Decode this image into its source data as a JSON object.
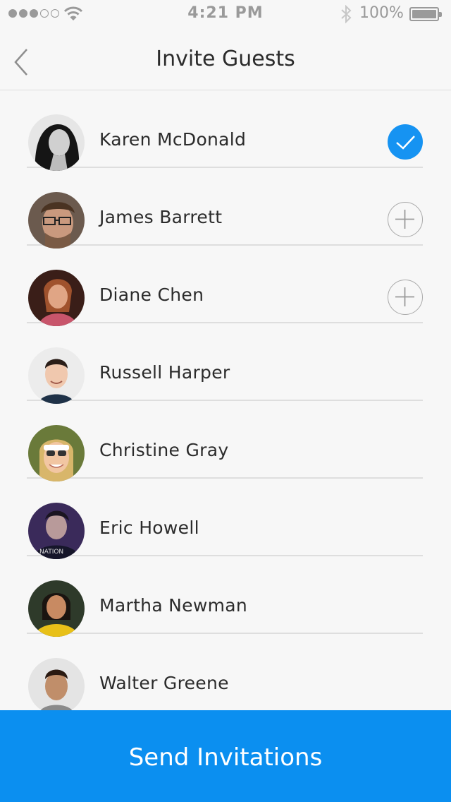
{
  "status_bar": {
    "time": "4:21 PM",
    "battery_percent": "100%",
    "signal_bars_filled": 3,
    "signal_bars_total": 5
  },
  "nav": {
    "title": "Invite Guests",
    "back_icon": "chevron-left-icon"
  },
  "guests": [
    {
      "name": "Karen McDonald",
      "action": "selected",
      "icon": "checkmark-icon"
    },
    {
      "name": "James Barrett",
      "action": "add",
      "icon": "plus-icon"
    },
    {
      "name": "Diane Chen",
      "action": "add",
      "icon": "plus-icon"
    },
    {
      "name": "Russell Harper",
      "action": "none"
    },
    {
      "name": "Christine Gray",
      "action": "none"
    },
    {
      "name": "Eric Howell",
      "action": "none"
    },
    {
      "name": "Martha Newman",
      "action": "none"
    },
    {
      "name": "Walter Greene",
      "action": "none"
    }
  ],
  "send_button": {
    "label": "Send Invitations"
  },
  "colors": {
    "accent": "#0b8ff0",
    "check": "#1693f2",
    "text": "#2b2b2b",
    "divider": "#dedede",
    "background": "#f7f7f7"
  }
}
